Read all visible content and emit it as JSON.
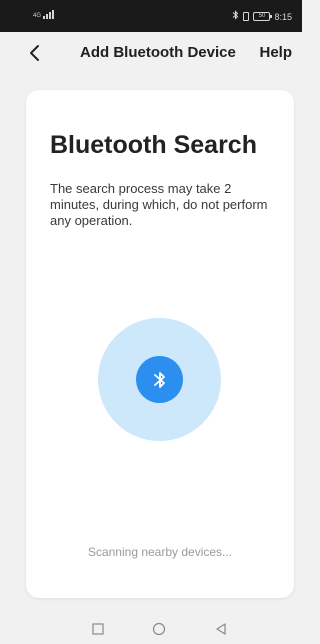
{
  "status_bar": {
    "signal_label": "4G",
    "battery_level": "50",
    "time": "8:15",
    "icons": [
      "signal-icon",
      "bluetooth-icon",
      "vibrate-icon",
      "battery-icon"
    ]
  },
  "header": {
    "title": "Add Bluetooth Device",
    "help_label": "Help",
    "back_icon": "chevron-left-icon"
  },
  "card": {
    "title": "Bluetooth Search",
    "description": "The search process may take 2 minutes, during which, do not perform any operation.",
    "scan_icon": "bluetooth-icon",
    "status_text": "Scanning nearby devices..."
  },
  "system_nav": {
    "items": [
      "recents-square-icon",
      "home-circle-icon",
      "back-triangle-icon"
    ]
  },
  "colors": {
    "accent": "#2c8ff0",
    "halo": "#cde7fb",
    "background": "#f1f1f1",
    "status_bar": "#1a1a1a"
  }
}
